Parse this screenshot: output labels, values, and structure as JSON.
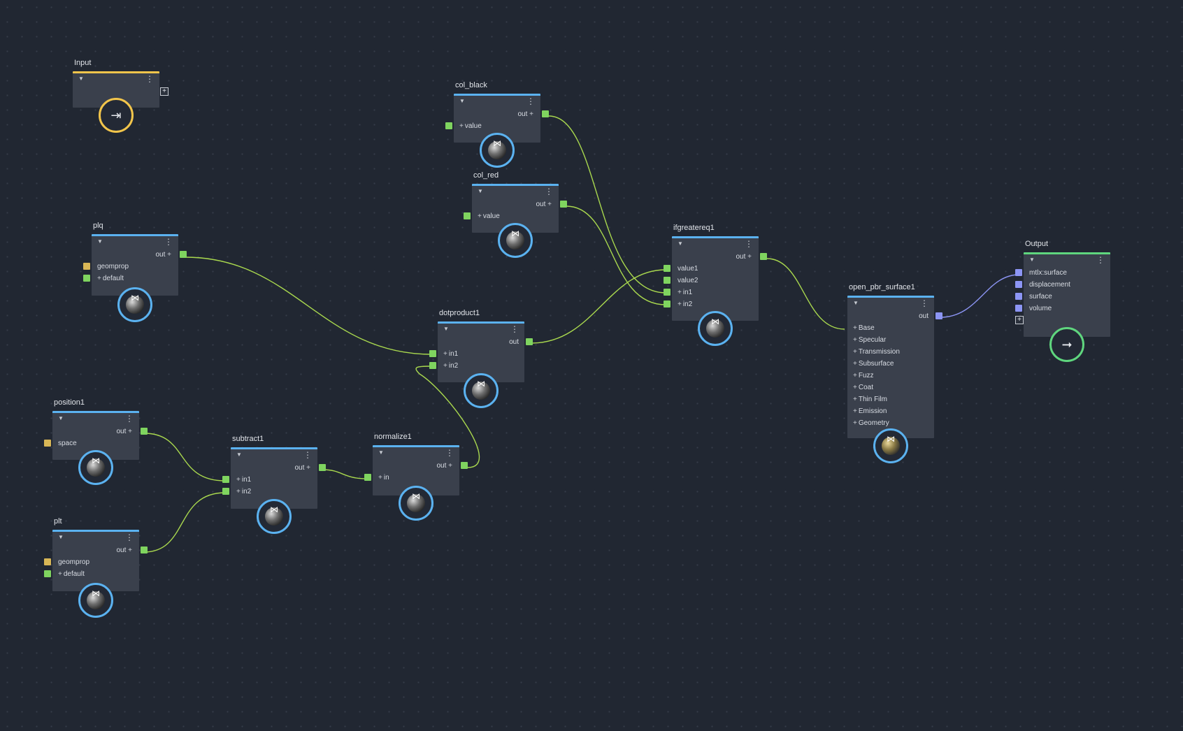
{
  "canvas": {
    "background": "#212732",
    "grid": "dotted"
  },
  "colors": {
    "accent_blue": "#5bb2f0",
    "port_green": "#7fd45f",
    "port_yellow": "#d8b656",
    "port_purple": "#8c95f4",
    "input_gold": "#f2c54b",
    "output_green": "#5fd67e"
  },
  "nodes": {
    "input": {
      "title": "Input"
    },
    "col_black": {
      "title": "col_black",
      "out": "out",
      "inputs": [
        "value"
      ]
    },
    "col_red": {
      "title": "col_red",
      "out": "out",
      "inputs": [
        "value"
      ]
    },
    "plq": {
      "title": "plq",
      "out": "out",
      "inputs": [
        "geomprop",
        "default"
      ]
    },
    "dotproduct1": {
      "title": "dotproduct1",
      "out": "out",
      "inputs": [
        "in1",
        "in2"
      ]
    },
    "ifgreatereq1": {
      "title": "ifgreatereq1",
      "out": "out",
      "inputs": [
        "value1",
        "value2",
        "in1",
        "in2"
      ]
    },
    "open_pbr_surface1": {
      "title": "open_pbr_surface1",
      "out": "out",
      "groups": [
        "Base",
        "Specular",
        "Transmission",
        "Subsurface",
        "Fuzz",
        "Coat",
        "Thin Film",
        "Emission",
        "Geometry"
      ]
    },
    "output": {
      "title": "Output",
      "inputs": [
        "mtlx:surface",
        "displacement",
        "surface",
        "volume"
      ]
    },
    "position1": {
      "title": "position1",
      "out": "out",
      "inputs": [
        "space"
      ]
    },
    "subtract1": {
      "title": "subtract1",
      "out": "out",
      "inputs": [
        "in1",
        "in2"
      ]
    },
    "normalize1": {
      "title": "normalize1",
      "out": "out",
      "inputs": [
        "in"
      ]
    },
    "plt": {
      "title": "plt",
      "out": "out",
      "inputs": [
        "geomprop",
        "default"
      ]
    }
  }
}
